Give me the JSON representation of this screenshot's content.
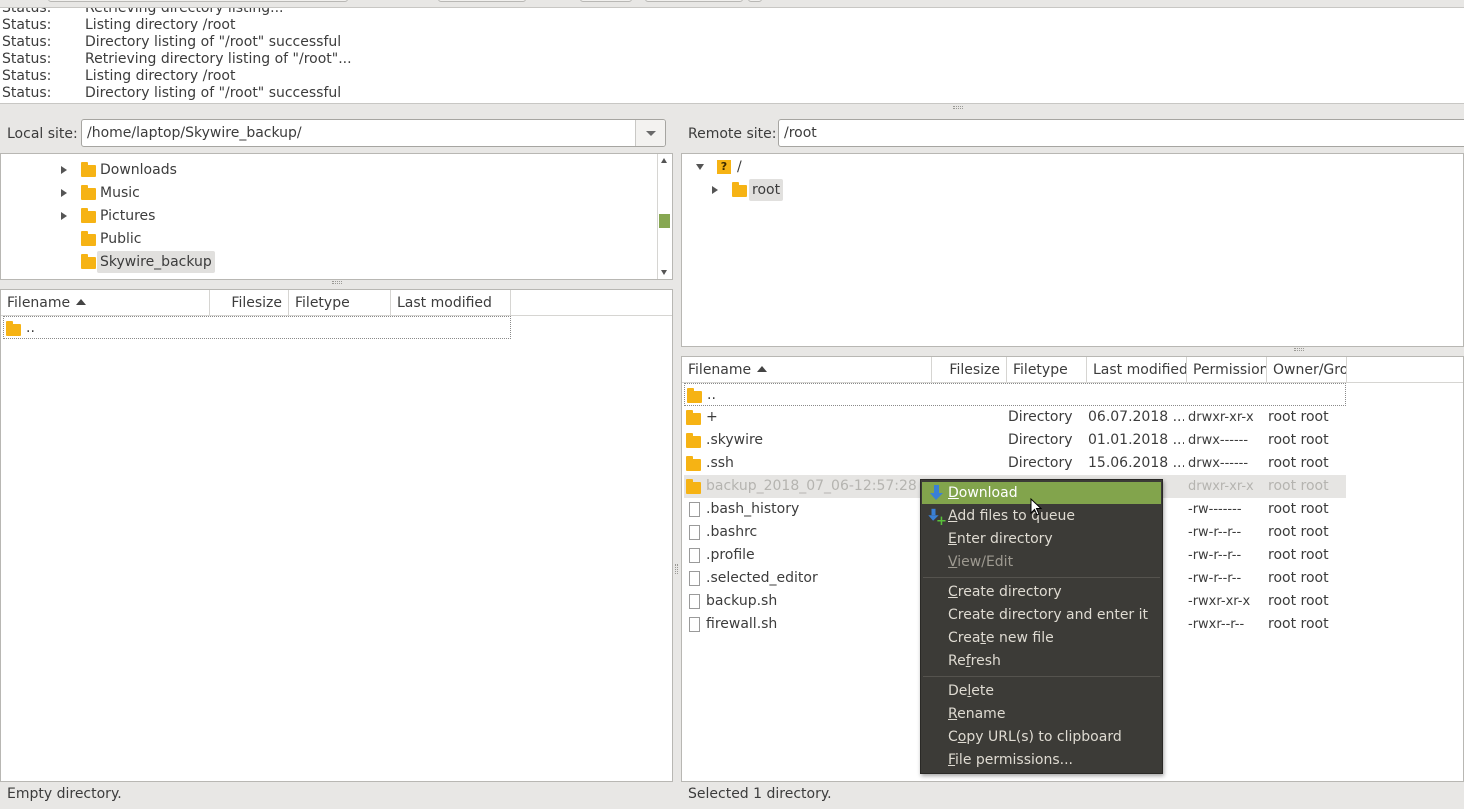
{
  "log": {
    "entries": [
      {
        "label": "Status:",
        "message": "Retrieving directory listing..."
      },
      {
        "label": "Status:",
        "message": "Listing directory /root"
      },
      {
        "label": "Status:",
        "message": "Directory listing of \"/root\" successful"
      },
      {
        "label": "Status:",
        "message": "Retrieving directory listing of \"/root\"..."
      },
      {
        "label": "Status:",
        "message": "Listing directory /root"
      },
      {
        "label": "Status:",
        "message": "Directory listing of \"/root\" successful"
      }
    ]
  },
  "local": {
    "site_label": "Local site:",
    "path": "/home/laptop/Skywire_backup/",
    "tree": [
      {
        "name": "Downloads",
        "has_children": true
      },
      {
        "name": "Music",
        "has_children": true
      },
      {
        "name": "Pictures",
        "has_children": true
      },
      {
        "name": "Public",
        "has_children": false
      },
      {
        "name": "Skywire_backup",
        "has_children": false,
        "selected": true
      }
    ],
    "columns": [
      "Filename",
      "Filesize",
      "Filetype",
      "Last modified"
    ],
    "files": [
      {
        "name": ".."
      }
    ],
    "status": "Empty directory."
  },
  "remote": {
    "site_label": "Remote site:",
    "path": "/root",
    "tree": {
      "root": "/",
      "child": "root"
    },
    "columns": [
      "Filename",
      "Filesize",
      "Filetype",
      "Last modified",
      "Permission",
      "Owner/Gro"
    ],
    "files": [
      {
        "name": "..",
        "type": "",
        "modified": "",
        "perm": "",
        "owner": "",
        "kind": "folder"
      },
      {
        "name": "+",
        "type": "Directory",
        "modified": "06.07.2018 ...",
        "perm": "drwxr-xr-x",
        "owner": "root root",
        "kind": "folder"
      },
      {
        "name": ".skywire",
        "type": "Directory",
        "modified": "01.01.2018 ...",
        "perm": "drwx------",
        "owner": "root root",
        "kind": "folder"
      },
      {
        "name": ".ssh",
        "type": "Directory",
        "modified": "15.06.2018 ...",
        "perm": "drwx------",
        "owner": "root root",
        "kind": "folder"
      },
      {
        "name": "backup_2018_07_06-12:57:28",
        "type": "",
        "modified": "",
        "perm": "drwxr-xr-x",
        "owner": "root root",
        "kind": "folder",
        "selected": true
      },
      {
        "name": ".bash_history",
        "type": "",
        "modified": "...",
        "perm": "-rw-------",
        "owner": "root root",
        "kind": "file"
      },
      {
        "name": ".bashrc",
        "type": "",
        "modified": "...",
        "perm": "-rw-r--r--",
        "owner": "root root",
        "kind": "file"
      },
      {
        "name": ".profile",
        "type": "",
        "modified": "...",
        "perm": "-rw-r--r--",
        "owner": "root root",
        "kind": "file"
      },
      {
        "name": ".selected_editor",
        "type": "",
        "modified": "...",
        "perm": "-rw-r--r--",
        "owner": "root root",
        "kind": "file"
      },
      {
        "name": "backup.sh",
        "type": "",
        "modified": "...",
        "perm": "-rwxr-xr-x",
        "owner": "root root",
        "kind": "file"
      },
      {
        "name": "firewall.sh",
        "type": "",
        "modified": "...",
        "perm": "-rwxr--r--",
        "owner": "root root",
        "kind": "file"
      }
    ],
    "status": "Selected 1 directory."
  },
  "context_menu": {
    "groups": [
      [
        {
          "pre": "",
          "u": "D",
          "post": "ownload",
          "icon": "download-icon",
          "highlighted": true
        },
        {
          "pre": "",
          "u": "A",
          "post": "dd files to queue",
          "icon": "add-to-queue-icon"
        },
        {
          "pre": "",
          "u": "E",
          "post": "nter directory"
        },
        {
          "pre": "",
          "u": "V",
          "post": "iew/Edit",
          "disabled": true
        }
      ],
      [
        {
          "pre": "",
          "u": "C",
          "post": "reate directory"
        },
        {
          "pre": "Create directory and enter it",
          "u": "",
          "post": ""
        },
        {
          "pre": "Crea",
          "u": "t",
          "post": "e new file"
        },
        {
          "pre": "Re",
          "u": "f",
          "post": "resh"
        }
      ],
      [
        {
          "pre": "De",
          "u": "l",
          "post": "ete"
        },
        {
          "pre": "",
          "u": "R",
          "post": "ename"
        },
        {
          "pre": "C",
          "u": "o",
          "post": "py URL(s) to clipboard"
        },
        {
          "pre": "",
          "u": "F",
          "post": "ile permissions..."
        }
      ]
    ]
  }
}
